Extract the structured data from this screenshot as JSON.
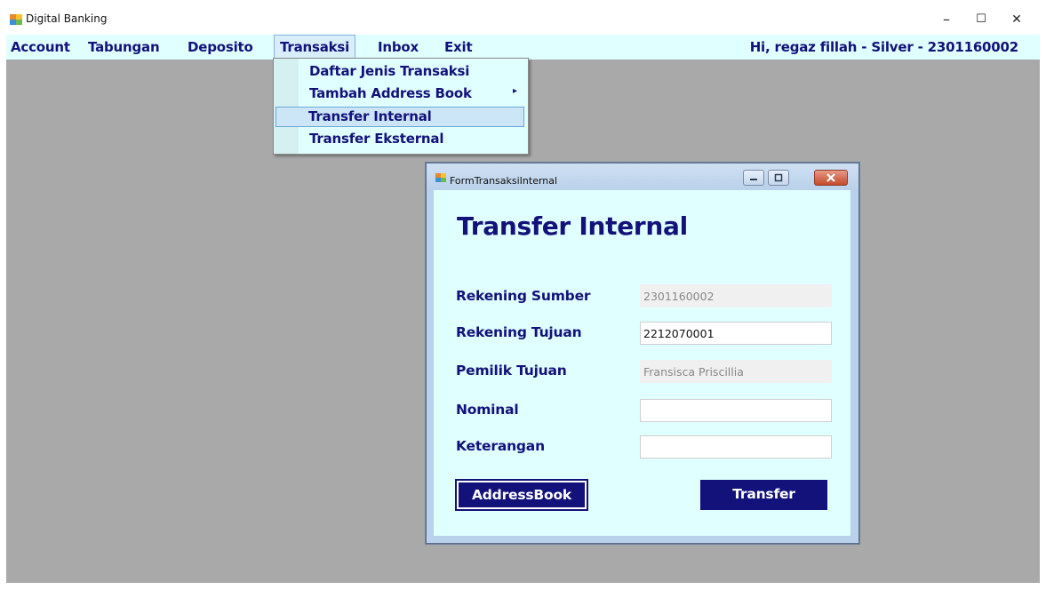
{
  "window": {
    "title": "Digital Banking",
    "controls": {
      "minimize": "–",
      "maximize": "☐",
      "close": "✕"
    }
  },
  "menubar": {
    "items": [
      {
        "label": "Account"
      },
      {
        "label": "Tabungan"
      },
      {
        "label": "Deposito"
      },
      {
        "label": "Transaksi",
        "active": true
      },
      {
        "label": "Inbox"
      },
      {
        "label": "Exit"
      }
    ],
    "greeting": "Hi, regaz fillah - Silver - 2301160002"
  },
  "dropdown": {
    "items": [
      {
        "label": "Daftar Jenis Transaksi"
      },
      {
        "label": "Tambah Address Book",
        "submenu_arrow": "▸"
      },
      {
        "label": "Transfer Internal",
        "highlighted": true
      },
      {
        "label": "Transfer Eksternal"
      }
    ]
  },
  "child_form": {
    "window_title": "FormTransaksiInternal",
    "heading": "Transfer Internal",
    "fields": {
      "rekening_sumber": {
        "label": "Rekening Sumber",
        "value": "2301160002"
      },
      "rekening_tujuan": {
        "label": "Rekening Tujuan",
        "value": "2212070001"
      },
      "pemilik_tujuan": {
        "label": "Pemilik Tujuan",
        "value": "Fransisca Priscillia"
      },
      "nominal": {
        "label": "Nominal",
        "value": ""
      },
      "keterangan": {
        "label": "Keterangan",
        "value": ""
      }
    },
    "buttons": {
      "addressbook": "AddressBook",
      "transfer": "Transfer"
    }
  },
  "colors": {
    "accent_navy": "#13127a",
    "menu_bg": "#e0ffff",
    "mdi_bg": "#a9a9a9"
  }
}
